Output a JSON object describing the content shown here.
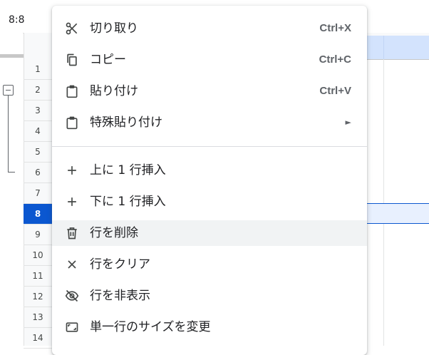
{
  "namebox": {
    "value": "8:8"
  },
  "rows": {
    "numbers": [
      "1",
      "2",
      "3",
      "4",
      "5",
      "6",
      "7",
      "8",
      "9",
      "10",
      "11",
      "12",
      "13",
      "14"
    ],
    "selected": "8"
  },
  "context_menu": {
    "items": [
      {
        "label": "切り取り",
        "shortcut": "Ctrl+X",
        "icon": "scissors-icon"
      },
      {
        "label": "コピー",
        "shortcut": "Ctrl+C",
        "icon": "copy-icon"
      },
      {
        "label": "貼り付け",
        "shortcut": "Ctrl+V",
        "icon": "clipboard-icon"
      },
      {
        "label": "特殊貼り付け",
        "submenu": "►",
        "icon": "clipboard-icon"
      },
      {
        "label": "上に 1 行挿入",
        "icon": "plus-icon"
      },
      {
        "label": "下に 1 行挿入",
        "icon": "plus-icon"
      },
      {
        "label": "行を削除",
        "icon": "trash-icon",
        "hovered": true
      },
      {
        "label": "行をクリア",
        "icon": "close-icon"
      },
      {
        "label": "行を非表示",
        "icon": "eye-off-icon"
      },
      {
        "label": "単一行のサイズを変更",
        "icon": "resize-icon"
      }
    ]
  },
  "colors": {
    "selection_blue": "#0b57d0",
    "selection_light": "#d3e3fd",
    "hover_gray": "#f1f3f4"
  }
}
